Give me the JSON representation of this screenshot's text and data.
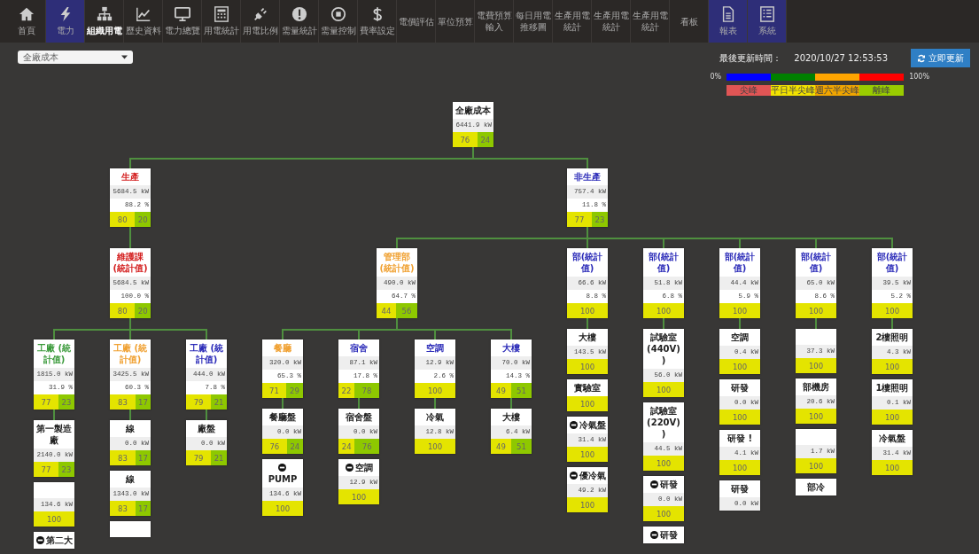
{
  "toolbar": {
    "items": [
      {
        "label": "首頁",
        "kind": "icon",
        "selected": false,
        "highlighted": false
      },
      {
        "label": "電力",
        "kind": "icon",
        "selected": false,
        "highlighted": true
      },
      {
        "label": "組織用電",
        "kind": "icon",
        "selected": true,
        "highlighted": false
      },
      {
        "label": "歷史資料",
        "kind": "icon",
        "selected": false,
        "highlighted": false
      },
      {
        "label": "電力總覽",
        "kind": "icon",
        "selected": false,
        "highlighted": false
      },
      {
        "label": "用電統計",
        "kind": "icon",
        "selected": false,
        "highlighted": false
      },
      {
        "label": "用電比例",
        "kind": "icon",
        "selected": false,
        "highlighted": false
      },
      {
        "label": "需量統計",
        "kind": "icon",
        "selected": false,
        "highlighted": false
      },
      {
        "label": "需量控制",
        "kind": "icon",
        "selected": false,
        "highlighted": false
      },
      {
        "label": "費率設定",
        "kind": "icon",
        "selected": false,
        "highlighted": false
      },
      {
        "label": "電價評估",
        "kind": "text",
        "selected": false,
        "highlighted": false
      },
      {
        "label": "單位預算",
        "kind": "text",
        "selected": false,
        "highlighted": false
      },
      {
        "label": "電費預算輸入",
        "kind": "text",
        "selected": false,
        "highlighted": false
      },
      {
        "label": "每日用電推移圖",
        "kind": "text",
        "selected": false,
        "highlighted": false
      },
      {
        "label": "生產用電統計",
        "kind": "text",
        "selected": false,
        "highlighted": false
      },
      {
        "label": "生產用電統計",
        "kind": "text",
        "selected": false,
        "highlighted": false
      },
      {
        "label": "生產用電統計",
        "kind": "text",
        "selected": false,
        "highlighted": false
      },
      {
        "label": "看板",
        "kind": "text",
        "selected": false,
        "highlighted": false
      },
      {
        "label": "報表",
        "kind": "icon",
        "selected": false,
        "highlighted": true
      },
      {
        "label": "系統",
        "kind": "icon",
        "selected": false,
        "highlighted": true
      }
    ]
  },
  "filter": {
    "value": "全廠成本"
  },
  "update": {
    "label": "最後更新時間：",
    "time": "2020/10/27 12:53:53",
    "button": "立即更新"
  },
  "legend": {
    "min_label": "0%",
    "max_label": "100%",
    "segments": [
      {
        "color": "#0000ff"
      },
      {
        "color": "#008000"
      },
      {
        "color": "#ffa500"
      },
      {
        "color": "#ff0000"
      }
    ],
    "labels": [
      {
        "text": "尖峰",
        "color": "#e05555"
      },
      {
        "text": "平日半尖峰",
        "color": "#f2e200"
      },
      {
        "text": "週六半尖峰",
        "color": "#f0a500"
      },
      {
        "text": "離峰",
        "color": "#99cc00"
      }
    ]
  },
  "tree": {
    "title": "全廠成本",
    "color": "#222222",
    "kw": "6441.9 kW",
    "split": [
      "76",
      "24"
    ],
    "children": [
      {
        "title": "生產",
        "color": "#d42020",
        "kw": "5684.5 kW",
        "pct": "88.2 %",
        "split": [
          "80",
          "20"
        ],
        "children": [
          {
            "title": "維護課(統計值)",
            "color": "#d42020",
            "kw": "5684.5 kW",
            "pct": "100.0 %",
            "split": [
              "80",
              "20"
            ],
            "children": [
              {
                "title": "工廠 (統計值)",
                "color": "#3a9a3a",
                "kw": "1815.0 kW",
                "pct": "31.9 %",
                "split": [
                  "77",
                  "23"
                ],
                "children": [
                  {
                    "title": "第一製造廠",
                    "color": "#222222",
                    "kw": "2140.0 kW",
                    "split": [
                      "77",
                      "23"
                    ],
                    "marked": false
                  },
                  {
                    "kw": "134.6 kW",
                    "split": [
                      "100"
                    ],
                    "marked": false
                  },
                  {
                    "title": "第二大",
                    "color": "#222222",
                    "marked": true
                  }
                ]
              },
              {
                "title": "工廠 (統計值)",
                "color": "#f0a030",
                "kw": "3425.5 kW",
                "pct": "60.3 %",
                "split": [
                  "83",
                  "17"
                ],
                "children": [
                  {
                    "title": "線",
                    "color": "#222222",
                    "kw": "0.0 kW",
                    "split": [
                      "83",
                      "17"
                    ],
                    "marked": false
                  },
                  {
                    "title": "線",
                    "color": "#222222",
                    "kw": "1343.0 kW",
                    "split": [
                      "83",
                      "17"
                    ],
                    "marked": false
                  },
                  {
                    "marked": false
                  }
                ]
              },
              {
                "title": "工廠 (統計值)",
                "color": "#2a2ab8",
                "kw": "444.0 kW",
                "pct": "7.8 %",
                "split": [
                  "79",
                  "21"
                ],
                "children": [
                  {
                    "title": "廠盤",
                    "color": "#222222",
                    "kw": "0.0 kW",
                    "split": [
                      "79",
                      "21"
                    ],
                    "marked": false
                  }
                ]
              }
            ]
          }
        ]
      },
      {
        "title": "非生產",
        "color": "#2a2ab8",
        "kw": "757.4 kW",
        "pct": "11.8 %",
        "split": [
          "77",
          "23"
        ],
        "children": [
          {
            "title": "管理部(統計值)",
            "color": "#f0a030",
            "kw": "490.0 kW",
            "pct": "64.7 %",
            "split": [
              "44",
              "56"
            ],
            "children": [
              {
                "title": "餐廳",
                "color": "#f0a030",
                "kw": "320.0 kW",
                "pct": "65.3 %",
                "split": [
                  "71",
                  "29"
                ],
                "children": [
                  {
                    "title": "餐廳盤",
                    "color": "#222222",
                    "kw": "0.0 kW",
                    "split": [
                      "76",
                      "24"
                    ],
                    "marked": false
                  },
                  {
                    "title": "PUMP",
                    "color": "#222222",
                    "kw": "134.6 kW",
                    "split": [
                      "100"
                    ],
                    "marked": true
                  }
                ]
              },
              {
                "title": "宿舍",
                "color": "#2a2ab8",
                "kw": "87.1 kW",
                "pct": "17.8 %",
                "split": [
                  "22",
                  "78"
                ],
                "children": [
                  {
                    "title": "宿舍盤",
                    "color": "#222222",
                    "kw": "0.0 kW",
                    "split": [
                      "24",
                      "76"
                    ],
                    "marked": false
                  },
                  {
                    "title": "空調",
                    "color": "#222222",
                    "kw": "12.9 kW",
                    "split": [
                      "100"
                    ],
                    "marked": true
                  }
                ]
              },
              {
                "title": "空調",
                "color": "#2a2ab8",
                "kw": "12.9 kW",
                "pct": "2.6 %",
                "split": [
                  "100"
                ],
                "children": [
                  {
                    "title": "冷氣",
                    "color": "#222222",
                    "kw": "12.8 kW",
                    "split": [
                      "100"
                    ],
                    "marked": false
                  }
                ]
              },
              {
                "title": "大樓",
                "color": "#2a2ab8",
                "kw": "70.0 kW",
                "pct": "14.3 %",
                "split": [
                  "49",
                  "51"
                ],
                "children": [
                  {
                    "title": "大樓",
                    "color": "#222222",
                    "kw": "6.4 kW",
                    "split": [
                      "49",
                      "51"
                    ],
                    "marked": false
                  }
                ]
              }
            ]
          },
          {
            "title": "部(統計值)",
            "color": "#2a2ab8",
            "kw": "66.6 kW",
            "pct": "8.8 %",
            "split": [
              "100"
            ],
            "children": [
              {
                "title": "大樓",
                "color": "#222222",
                "kw": "143.5 kW",
                "split": [
                  "100"
                ],
                "marked": false
              },
              {
                "title": "實驗室",
                "color": "#222222",
                "split": [
                  "100"
                ],
                "marked": false
              },
              {
                "title": "冷氣盤",
                "color": "#222222",
                "kw": "31.4 kW",
                "split": [
                  "100"
                ],
                "marked": true
              },
              {
                "title": "優冷氣",
                "color": "#222222",
                "kw": "49.2 kW",
                "split": [
                  "100"
                ],
                "marked": true
              }
            ]
          },
          {
            "title": "部(統計值)",
            "color": "#2a2ab8",
            "kw": "51.8 kW",
            "pct": "6.8 %",
            "split": [
              "100"
            ],
            "children": [
              {
                "title": "試驗室(440V))",
                "color": "#222222",
                "kw": "56.0 kW",
                "split": [
                  "100"
                ],
                "marked": false
              },
              {
                "title": "試驗室(220V))",
                "color": "#222222",
                "kw": "44.5 kW",
                "split": [
                  "100"
                ],
                "marked": false
              },
              {
                "title": "研發",
                "color": "#222222",
                "kw": "0.0 kW",
                "split": [
                  "100"
                ],
                "marked": true
              },
              {
                "title": "研發",
                "color": "#222222",
                "marked": true
              }
            ]
          },
          {
            "title": "部(統計值)",
            "color": "#2a2ab8",
            "kw": "44.4 kW",
            "pct": "5.9 %",
            "split": [
              "100"
            ],
            "children": [
              {
                "title": "空調",
                "color": "#222222",
                "kw": "0.4 kW",
                "split": [
                  "100"
                ],
                "marked": false
              },
              {
                "title": "研發",
                "color": "#222222",
                "kw": "0.0 kW",
                "split": [
                  "100"
                ],
                "marked": false
              },
              {
                "title": "研發 !",
                "color": "#222222",
                "kw": "4.1 kW",
                "split": [
                  "100"
                ],
                "marked": false
              },
              {
                "title": "研發",
                "color": "#222222",
                "kw": "0.0 kW",
                "marked": false
              }
            ]
          },
          {
            "title": "部(統計值)",
            "color": "#2a2ab8",
            "kw": "65.0 kW",
            "pct": "8.6 %",
            "split": [
              "100"
            ],
            "children": [
              {
                "kw": "37.3 kW",
                "split": [
                  "100"
                ],
                "marked": false
              },
              {
                "title": "部機房",
                "color": "#222222",
                "kw": "20.6 kW",
                "split": [
                  "100"
                ],
                "marked": false
              },
              {
                "kw": "1.7 kW",
                "split": [
                  "100"
                ],
                "marked": false
              },
              {
                "title": "部冷",
                "color": "#222222",
                "marked": false
              }
            ]
          },
          {
            "title": "部(統計值)",
            "color": "#2a2ab8",
            "kw": "39.5 kW",
            "pct": "5.2 %",
            "split": [
              "100"
            ],
            "children": [
              {
                "title": "2樓照明",
                "color": "#222222",
                "kw": "4.3 kW",
                "split": [
                  "100"
                ],
                "marked": false
              },
              {
                "title": "1樓照明",
                "color": "#222222",
                "kw": "0.1 kW",
                "split": [
                  "100"
                ],
                "marked": false
              },
              {
                "title": "冷氣盤",
                "color": "#222222",
                "kw": "31.4 kW",
                "split": [
                  "100"
                ],
                "marked": false
              }
            ]
          }
        ]
      }
    ]
  }
}
